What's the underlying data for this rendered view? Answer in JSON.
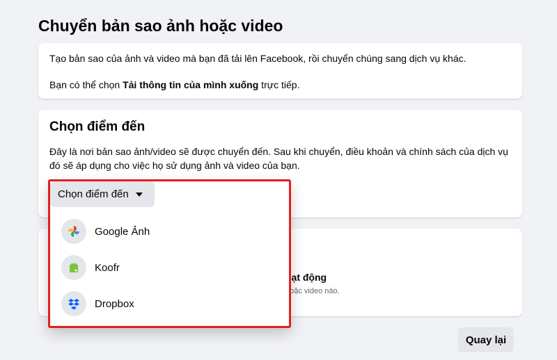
{
  "title": "Chuyển bản sao ảnh hoặc video",
  "intro": {
    "line1": "Tạo bản sao của ảnh và video mà bạn đã tải lên Facebook, rồi chuyển chúng sang dịch vụ khác.",
    "line2_prefix": "Bạn có thể chọn ",
    "line2_bold": "Tải thông tin của mình xuống",
    "line2_suffix": " trực tiếp."
  },
  "destination": {
    "heading": "Chọn điểm đến",
    "description": "Đây là nơi bản sao ảnh/video sẽ được chuyển đến. Sau khi chuyển, điều khoản và chính sách của dịch vụ đó sẽ áp dụng cho việc họ sử dụng ảnh và video của bạn.",
    "dropdown_label": "Chọn điểm đến",
    "options": [
      {
        "label": "Google Ảnh",
        "icon": "google-photos-icon"
      },
      {
        "label": "Koofr",
        "icon": "koofr-icon"
      },
      {
        "label": "Dropbox",
        "icon": "dropbox-icon"
      }
    ]
  },
  "activity": {
    "title_fragment": "oạt động",
    "desc_fragment": "hoặc video nào."
  },
  "back_label": "Quay lại",
  "colors": {
    "highlight": "#e41e1e",
    "dropbox": "#0061fe",
    "koofr": "#7cc242"
  }
}
